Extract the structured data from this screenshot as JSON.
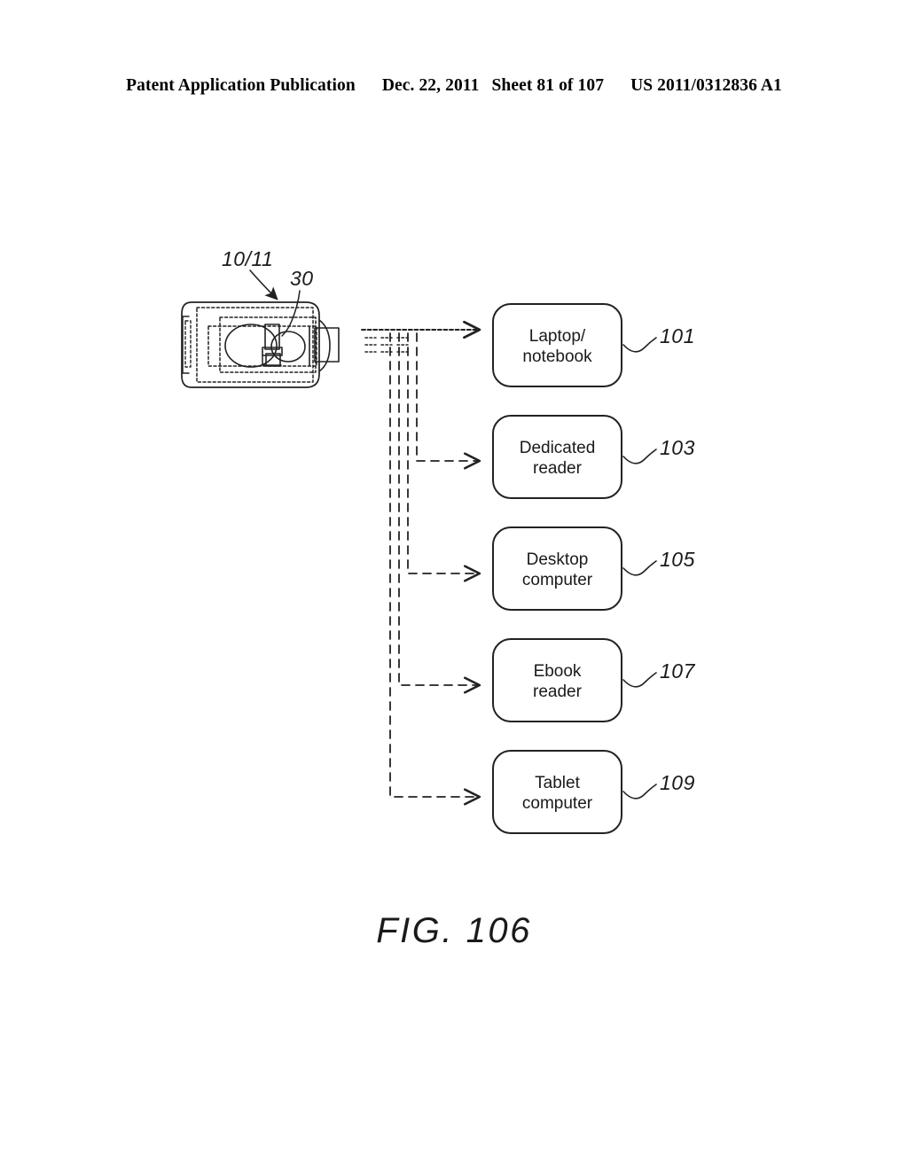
{
  "header": {
    "publication": "Patent Application Publication",
    "date": "Dec. 22, 2011",
    "sheet": "Sheet 81 of 107",
    "patent_number": "US 2011/0312836 A1"
  },
  "figure": {
    "caption": "FIG. 106",
    "source_device": {
      "name": "handheld-device",
      "callouts": [
        {
          "id": "device-ref",
          "text": "10/11"
        },
        {
          "id": "module-ref",
          "text": "30"
        }
      ]
    },
    "nodes": [
      {
        "id": "laptop",
        "label": "Laptop/\nnotebook",
        "ref": "101"
      },
      {
        "id": "reader",
        "label": "Dedicated\nreader",
        "ref": "103"
      },
      {
        "id": "desktop",
        "label": "Desktop\ncomputer",
        "ref": "105"
      },
      {
        "id": "ebook",
        "label": "Ebook\nreader",
        "ref": "107"
      },
      {
        "id": "tablet",
        "label": "Tablet\ncomputer",
        "ref": "109"
      }
    ],
    "colors": {
      "ink": "#1a1a1a",
      "line": "#222222",
      "background": "#ffffff"
    }
  }
}
